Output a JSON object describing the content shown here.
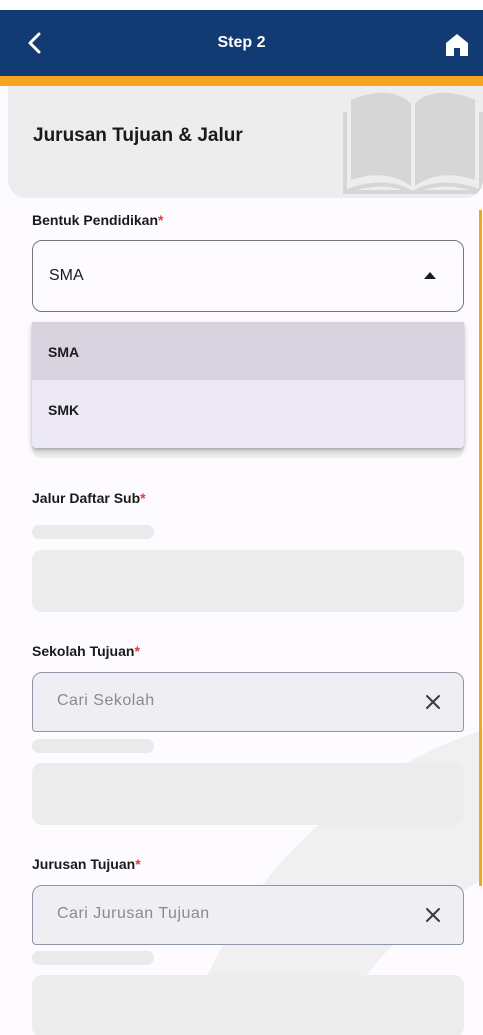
{
  "appbar": {
    "title": "Step 2",
    "back_icon": "back-arrow-icon",
    "home_icon": "home-icon"
  },
  "header": {
    "title": "Jurusan Tujuan & Jalur",
    "illustration": "book-icon"
  },
  "bentuk": {
    "label": "Bentuk Pendidikan",
    "required_mark": "*",
    "selected": "SMA",
    "options": [
      "SMA",
      "SMK"
    ]
  },
  "jalur": {
    "label": "Jalur Daftar Sub",
    "required_mark": "*"
  },
  "sekolah": {
    "label": "Sekolah Tujuan",
    "required_mark": "*",
    "placeholder": "Cari Sekolah"
  },
  "jurusan": {
    "label": "Jurusan Tujuan",
    "required_mark": "*",
    "placeholder": "Cari Jurusan Tujuan"
  },
  "colors": {
    "appbar": "#123a73",
    "accent": "#f6a41d",
    "required": "#e53935"
  }
}
